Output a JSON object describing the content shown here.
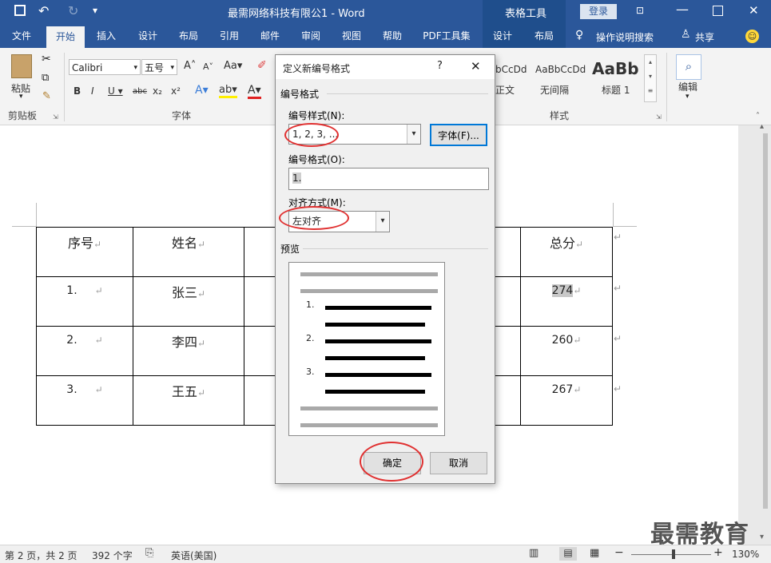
{
  "titlebar": {
    "title": "最需网络科技有限公1 - Word",
    "context_tab": "表格工具",
    "login": "登录"
  },
  "tabs": [
    "文件",
    "开始",
    "插入",
    "设计",
    "布局",
    "引用",
    "邮件",
    "审阅",
    "视图",
    "帮助",
    "PDF工具集",
    "设计",
    "布局"
  ],
  "tell_me": "操作说明搜索",
  "share": "共享",
  "ribbon": {
    "paste": "粘贴",
    "clipboard_label": "剪贴板",
    "font_name": "Calibri",
    "font_size": "五号",
    "font_label": "字体",
    "styles": [
      {
        "sample": "bCcDd",
        "name": "正文"
      },
      {
        "sample": "AaBbCcDd",
        "name": "无间隔"
      },
      {
        "sample": "AaBb",
        "name": "标题 1"
      }
    ],
    "styles_label": "样式",
    "edit": "编辑"
  },
  "table": {
    "headers": [
      "序号",
      "姓名",
      "",
      "",
      "总分"
    ],
    "rows": [
      {
        "num": "1.",
        "name": "张三",
        "total": "274"
      },
      {
        "num": "2.",
        "name": "李四",
        "total": "260"
      },
      {
        "num": "3.",
        "name": "王五",
        "total": "267"
      }
    ],
    "para_mark": "↵"
  },
  "dialog": {
    "title": "定义新编号格式",
    "help": "?",
    "close": "✕",
    "section_format": "编号格式",
    "style_label": "编号样式(N):",
    "style_value": "1, 2, 3, ...",
    "font_button": "字体(F)...",
    "format_label": "编号格式(O):",
    "format_value": "1.",
    "align_label": "对齐方式(M):",
    "align_value": "左对齐",
    "preview_label": "预览",
    "preview_nums": [
      "1.",
      "2.",
      "3."
    ],
    "ok": "确定",
    "cancel": "取消"
  },
  "status": {
    "page": "第 2 页，共 2 页",
    "words": "392 个字",
    "lang": "英语(美国)",
    "zoom": "130%"
  },
  "watermark": "最需教育"
}
